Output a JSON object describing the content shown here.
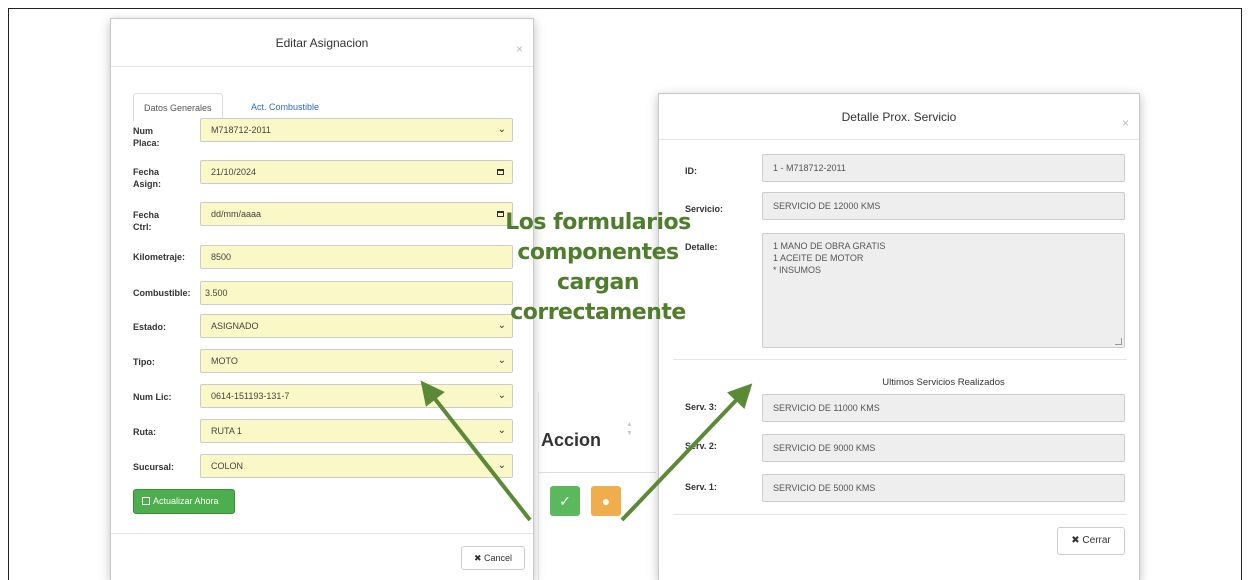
{
  "left_modal": {
    "title": "Editar Asignacion",
    "close": "×",
    "tabs": [
      {
        "label": "Datos Generales",
        "active": true
      },
      {
        "label": "Act. Combustible",
        "active": false
      }
    ],
    "fields": {
      "num_placa": {
        "label_line1": "Num",
        "label_line2": "Placa:",
        "value": "M718712-2011"
      },
      "fecha_asign": {
        "label_line1": "Fecha",
        "label_line2": "Asign:",
        "value": "21/10/2024"
      },
      "fecha_ctrl": {
        "label_line1": "Fecha",
        "label_line2": "Ctrl:",
        "value": "dd/mm/aaaa"
      },
      "kilometraje": {
        "label": "Kilometraje:",
        "value": "8500"
      },
      "combustible": {
        "label": "Combustible:",
        "value": "3.500"
      },
      "estado": {
        "label": "Estado:",
        "value": "ASIGNADO"
      },
      "tipo": {
        "label": "Tipo:",
        "value": "MOTO"
      },
      "num_lic": {
        "label": "Num Lic:",
        "value": "0614-151193-131-7"
      },
      "ruta": {
        "label": "Ruta:",
        "value": "RUTA 1"
      },
      "sucursal": {
        "label": "Sucursal:",
        "value": "COLON"
      }
    },
    "update_button": "Actualizar Ahora",
    "cancel_button": "Cancel"
  },
  "table_fragment": {
    "header": "Accion",
    "edit_icon": "edit-icon",
    "detail_icon": "info-badge-icon"
  },
  "right_modal": {
    "title": "Detalle Prox. Servicio",
    "close": "×",
    "id": {
      "label": "ID:",
      "value": "1 - M718712-2011"
    },
    "servicio": {
      "label": "Servicio:",
      "value": "SERVICIO DE 12000 KMS"
    },
    "detalle": {
      "label": "Detalle:",
      "lines": [
        "1 MANO DE OBRA GRATIS",
        "1 ACEITE DE MOTOR",
        "* INSUMOS"
      ]
    },
    "ultimos_title": "Ultimos Servicios Realizados",
    "serv3": {
      "label": "Serv. 3:",
      "value": "SERVICIO DE 11000 KMS"
    },
    "serv2": {
      "label": "Serv. 2:",
      "value": "SERVICIO DE 9000 KMS"
    },
    "serv1": {
      "label": "Serv. 1:",
      "value": "SERVICIO DE 5000 KMS"
    },
    "close_button": "Cerrar"
  },
  "annotation": {
    "lines": [
      "Los formularios",
      "componentes",
      "cargan",
      "correctamente"
    ],
    "color": "#4e7d2c"
  },
  "colors": {
    "field_highlight": "#fbf8c7",
    "readonly_field": "#eeeeee",
    "success": "#5cb85c",
    "warning": "#f0ad4e",
    "arrow": "#5b8a36"
  }
}
